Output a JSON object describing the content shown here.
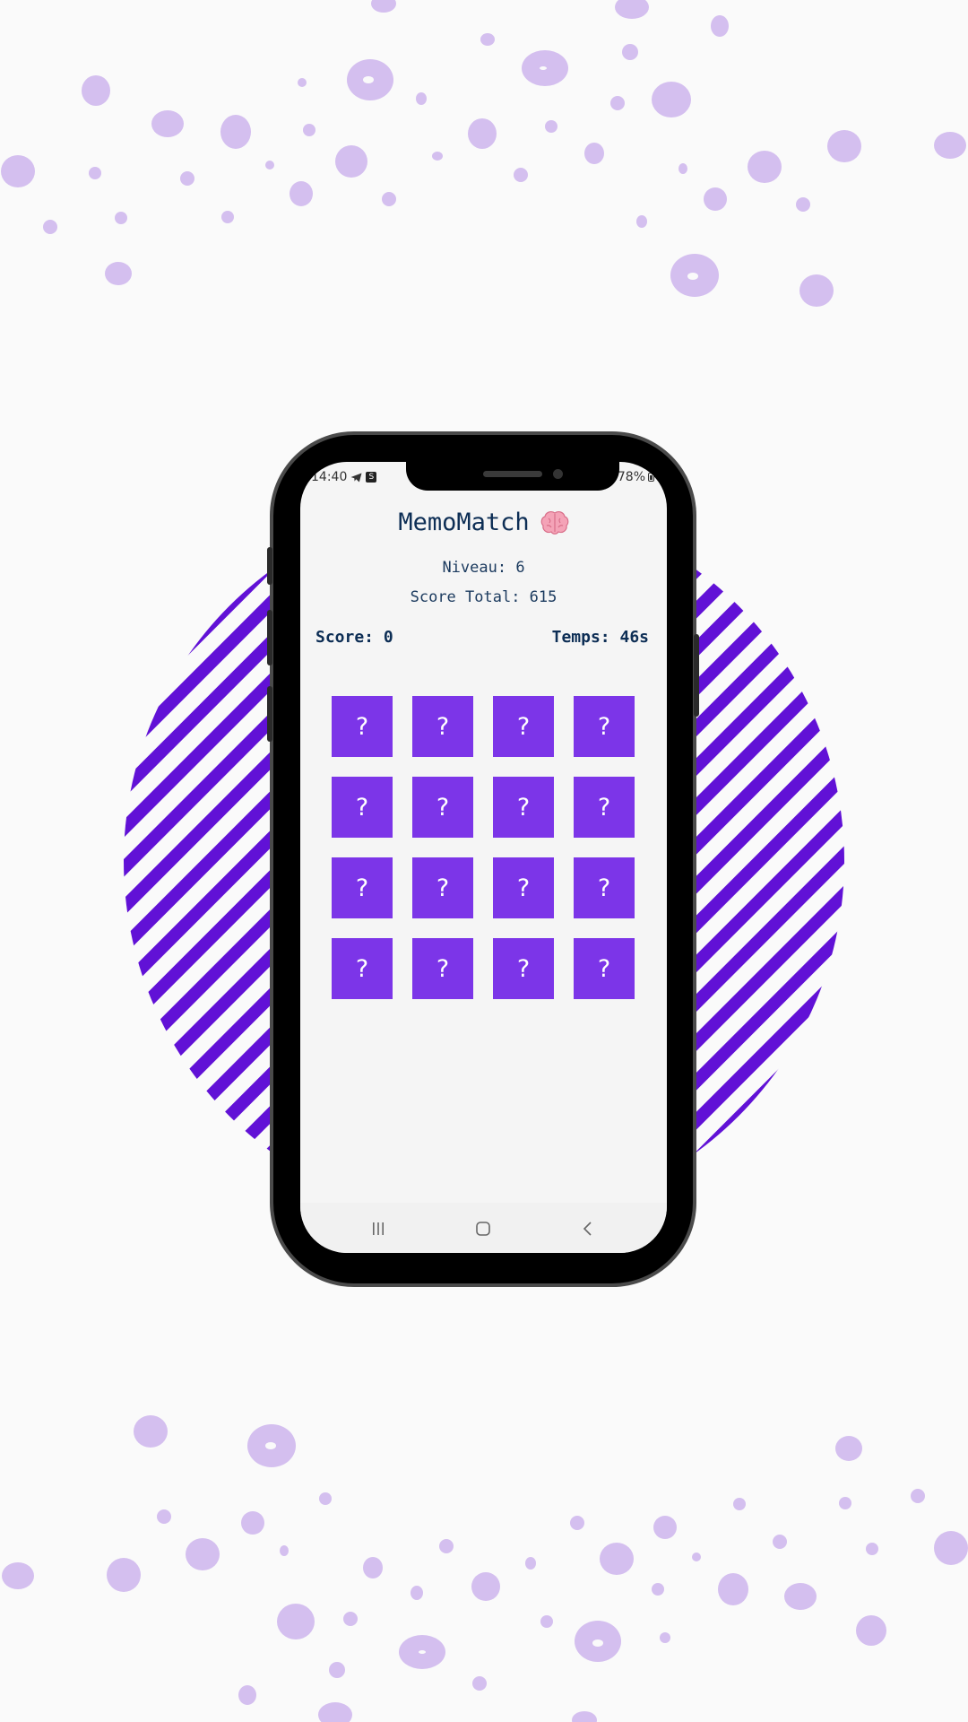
{
  "status_bar": {
    "time": "14:40",
    "app_badge": "S",
    "battery": "78%"
  },
  "app": {
    "title": "MemoMatch",
    "level_text": "Niveau: 6",
    "total_text": "Score Total: 615",
    "score_text": "Score: 0",
    "timer_text": "Temps: 46s"
  },
  "cards": [
    "?",
    "?",
    "?",
    "?",
    "?",
    "?",
    "?",
    "?",
    "?",
    "?",
    "?",
    "?",
    "?",
    "?",
    "?",
    "?"
  ],
  "colors": {
    "accent": "#7c35e8",
    "stripes": "#6111d6",
    "title": "#0d2e55",
    "blobs": "#d4bfef",
    "background": "#fafafa"
  },
  "icons": {
    "title_emoji": "brain-icon",
    "nav": [
      "recent-apps-icon",
      "home-icon",
      "back-icon"
    ]
  }
}
